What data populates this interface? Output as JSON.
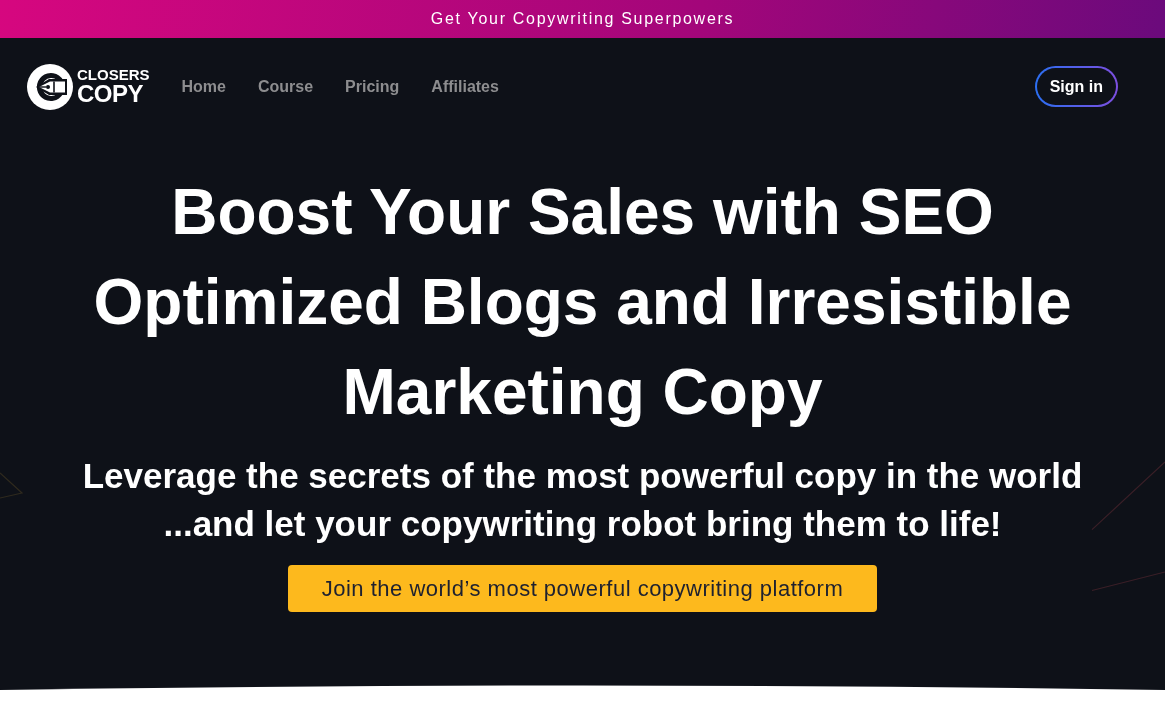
{
  "announcement_bar": {
    "text": "Get Your Copywriting Superpowers"
  },
  "navbar": {
    "logo": {
      "line_1": "CLOSERS",
      "line_2": "COPY"
    },
    "links": [
      {
        "label": "Home"
      },
      {
        "label": "Course"
      },
      {
        "label": "Pricing"
      },
      {
        "label": "Affiliates"
      }
    ],
    "sign_in": "Sign in"
  },
  "hero": {
    "headline": "Boost Your Sales with SEO Optimized Blogs and Irresistible Marketing Copy",
    "subheadline": "Leverage the secrets of the most powerful copy in the world ...and let your copywriting robot bring them to life!",
    "cta": "Join the world’s most powerful copywriting platform"
  }
}
